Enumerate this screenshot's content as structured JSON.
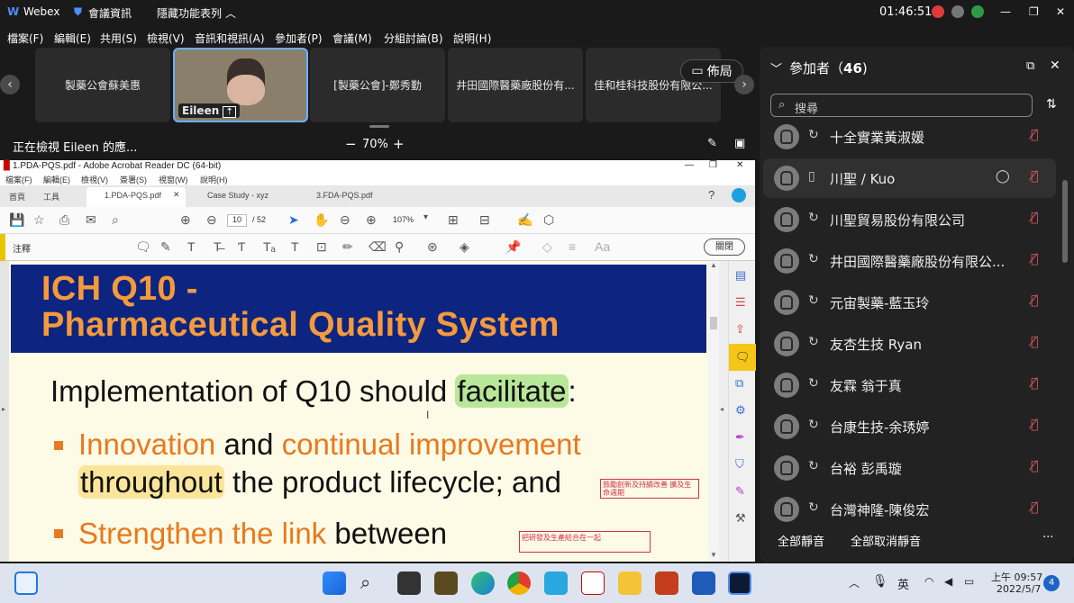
{
  "titlebar": {
    "app": "Webex",
    "meeting_info": "會議資訊",
    "hide_menu": "隱藏功能表列",
    "time": "01:46:51"
  },
  "menubar": [
    "檔案(F)",
    "編輯(E)",
    "共用(S)",
    "檢視(V)",
    "音訊和視訊(A)",
    "參加者(P)",
    "會議(M)",
    "分組討論(B)",
    "說明(H)"
  ],
  "thumbnails": [
    {
      "label": "製藥公會蘇美惠"
    },
    {
      "label": "Eileen"
    },
    {
      "label": "[製藥公會]-鄭秀勤"
    },
    {
      "label": "井田國際醫藥廠股份有..."
    },
    {
      "label": "佳和桂科技股份有限公..."
    }
  ],
  "layout_label": "佈局",
  "viewbar": {
    "viewing": "正在檢視 Eileen 的應...",
    "zoom": "70%",
    "minus": "−",
    "plus": "+"
  },
  "acrobat": {
    "title": "1.PDA-PQS.pdf - Adobe Acrobat Reader DC (64-bit)",
    "menu": [
      "檔案(F)",
      "編輯(E)",
      "檢視(V)",
      "簽署(S)",
      "視窗(W)",
      "說明(H)"
    ],
    "tabs": [
      "首頁",
      "工具",
      "1.PDA-PQS.pdf",
      "Case Study - xyz",
      "3.FDA-PQS.pdf"
    ],
    "page": "10",
    "page_total": "/ 52",
    "zoom": "107%",
    "annot_label": "注釋",
    "close_label": "關閉"
  },
  "slide": {
    "title1": "ICH Q10 -",
    "title2": "Pharmaceutical Quality System",
    "intro_pre": "Implementation of Q10 should ",
    "intro_hl": "facilitate",
    "intro_post": ":",
    "b1_a": "Innovation",
    "b1_b": " and ",
    "b1_c": "continual improvement",
    "b1_d": "throughout",
    "b1_e": " the product lifecycle; and",
    "b2_a": "Strengthen the link",
    "b2_b": " between",
    "note1": "鼓勵創新及持續改善 擴及生命週期",
    "note2": "把研發及生產結合在一起"
  },
  "participants": {
    "title": "參加者（",
    "count": "46",
    "close": ")",
    "search_placeholder": "搜尋",
    "items": [
      {
        "name": "十全實業黃淑媛"
      },
      {
        "name": "川聖 / Kuo"
      },
      {
        "name": "川聖貿易股份有限公司"
      },
      {
        "name": "井田國際醫藥廠股份有限公..."
      },
      {
        "name": "元宙製藥-藍玉玲"
      },
      {
        "name": "友杏生技 Ryan"
      },
      {
        "name": "友霖 翁于真"
      },
      {
        "name": "台康生技-余琇婷"
      },
      {
        "name": "台裕 彭禹璇"
      },
      {
        "name": "台灣神隆-陳俊宏"
      }
    ],
    "mute_all": "全部靜音",
    "unmute_all": "全部取消靜音",
    "more": "..."
  },
  "taskbar": {
    "ime": "英",
    "time": "上午 09:57",
    "date": "2022/5/7",
    "badge": "4"
  },
  "colors": {
    "banner": "#0d2580",
    "title": "#f59a3c",
    "accent_orange": "#e8791f",
    "muted": "#e05a64"
  }
}
